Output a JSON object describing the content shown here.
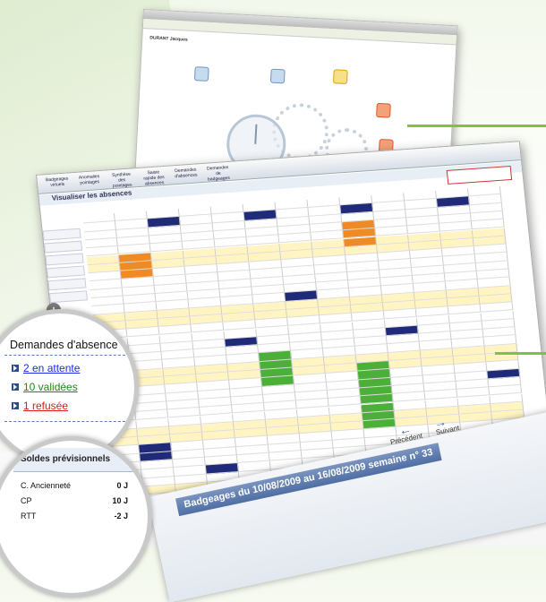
{
  "top_screenshot": {
    "user_name": "DURANT Jacques"
  },
  "main_screenshot": {
    "page_title": "Visualiser les absences",
    "menu": [
      "Badgeages virtuels",
      "Anomalies pointages",
      "Synthèse des pointages",
      "Saisie rapide des absences",
      "Demandes d'absences",
      "Demandes de badgeages"
    ]
  },
  "absences_panel": {
    "title": "Demandes d'absence",
    "items": [
      {
        "label": "2 en attente",
        "color": "#1a2ce0"
      },
      {
        "label": "10 validées",
        "color": "#1a8a1a"
      },
      {
        "label": "1 refusée",
        "color": "#e01a1a"
      }
    ]
  },
  "soldes_panel": {
    "title": "Soldes prévisionnels",
    "rows": [
      {
        "label": "C. Ancienneté",
        "value": "0 J"
      },
      {
        "label": "CP",
        "value": "10 J"
      },
      {
        "label": "RTT",
        "value": "-2 J"
      }
    ]
  },
  "badge_screenshot": {
    "title": "Badgeages du 10/08/2009 au 16/08/2009 semaine n° 33",
    "prev_label": "Précédent",
    "next_label": "Suivant"
  },
  "colors": {
    "accent_green": "#7dc241",
    "planning_navy": "#1f2a78",
    "planning_orange": "#f08a24",
    "planning_green": "#4caf3a",
    "planning_yellow": "#fff4c2"
  }
}
